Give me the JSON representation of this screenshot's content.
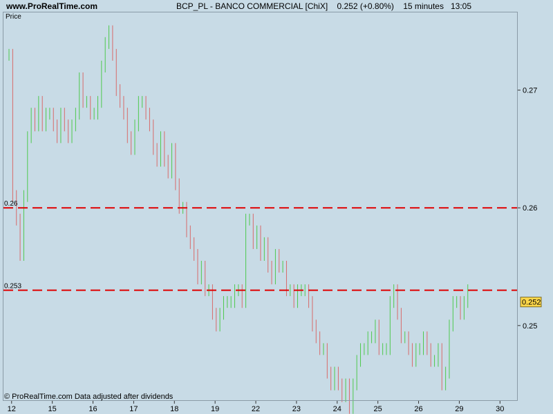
{
  "header": {
    "site": "www.ProRealTime.com",
    "title": "BCP_PL - BANCO COMMERCIAL [ChiX]",
    "last": "0.252 (+0.80%)",
    "interval": "15 minutes",
    "time": "13:05"
  },
  "footer": "© ProRealTime.com  Data adjusted after dividends",
  "colors": {
    "up": "#4ec94e",
    "down": "#d86a6a",
    "level": "#e00000",
    "background": "#c8dbe6"
  },
  "chart_data": {
    "type": "bar",
    "panel_label": "Price",
    "ylim": [
      0.2436,
      0.2766
    ],
    "y_ticks": [
      0.25,
      0.26,
      0.27
    ],
    "y_tick_labels": [
      "0.25",
      "0.26",
      "0.27"
    ],
    "x_tick_labels": [
      "12",
      "15",
      "16",
      "17",
      "18",
      "19",
      "22",
      "23",
      "24",
      "25",
      "26",
      "29",
      "30"
    ],
    "x_tick_positions": [
      2.2,
      13.2,
      24.2,
      35.2,
      46.2,
      57.2,
      68.2,
      79.2,
      90.2,
      101.2,
      112.2,
      123.2,
      134.2
    ],
    "x_range": [
      0,
      139
    ],
    "horizontal_levels": [
      {
        "value": 0.26,
        "label": "0.26"
      },
      {
        "value": 0.253,
        "label": "0.253"
      }
    ],
    "last_price": {
      "value": 0.252,
      "label": "0.252"
    },
    "grid": false,
    "closes": [
      0.273,
      0.261,
      0.259,
      0.256,
      0.261,
      0.266,
      0.268,
      0.267,
      0.269,
      0.267,
      0.268,
      0.268,
      0.267,
      0.266,
      0.268,
      0.267,
      0.266,
      0.267,
      0.268,
      0.271,
      0.269,
      0.269,
      0.268,
      0.268,
      0.269,
      0.272,
      0.274,
      0.275,
      0.273,
      0.27,
      0.269,
      0.268,
      0.266,
      0.265,
      0.267,
      0.269,
      0.269,
      0.268,
      0.267,
      0.265,
      0.264,
      0.266,
      0.264,
      0.263,
      0.265,
      0.262,
      0.26,
      0.26,
      0.258,
      0.257,
      0.256,
      0.254,
      0.255,
      0.253,
      0.253,
      0.251,
      0.25,
      0.251,
      0.252,
      0.252,
      0.252,
      0.253,
      0.253,
      0.252,
      0.259,
      0.259,
      0.257,
      0.258,
      0.256,
      0.257,
      0.255,
      0.254,
      0.256,
      0.255,
      0.255,
      0.253,
      0.253,
      0.252,
      0.253,
      0.253,
      0.253,
      0.252,
      0.25,
      0.249,
      0.248,
      0.248,
      0.246,
      0.245,
      0.246,
      0.245,
      0.244,
      0.245,
      0.243,
      0.245,
      0.247,
      0.248,
      0.248,
      0.249,
      0.249,
      0.25,
      0.248,
      0.248,
      0.248,
      0.252,
      0.253,
      0.251,
      0.249,
      0.249,
      0.248,
      0.247,
      0.248,
      0.248,
      0.249,
      0.248,
      0.247,
      0.247,
      0.248,
      0.245,
      0.246,
      0.25,
      0.252,
      0.252,
      0.251,
      0.252,
      0.253
    ]
  }
}
